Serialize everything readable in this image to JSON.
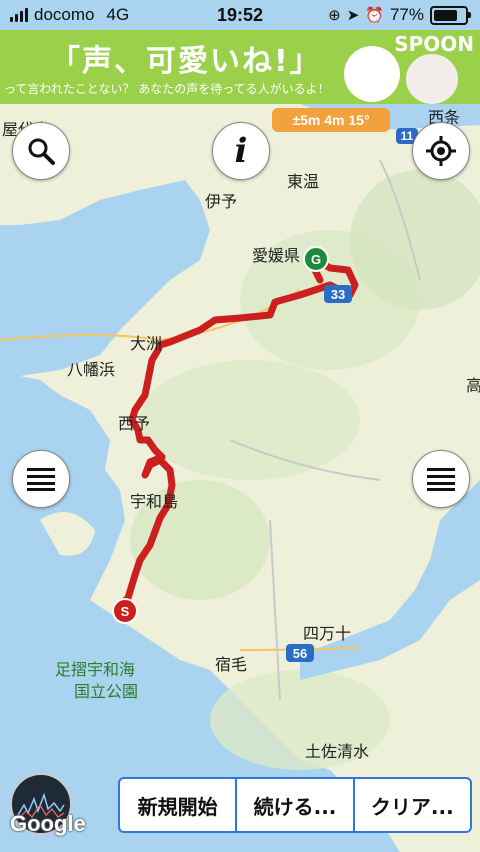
{
  "status_bar": {
    "carrier": "docomo",
    "network": "4G",
    "time": "19:52",
    "battery": "77%",
    "battery_level": 0.77
  },
  "ad": {
    "headline": "「声、可愛いね!」",
    "subtext": "って言われたことない？ あなたの声を待ってる人がいるよ！",
    "brand": "SPOON"
  },
  "gps_accuracy": "±5m 4m 15°",
  "map": {
    "labels": {
      "matsuyama_partial": "屋代島",
      "iyo": "伊予",
      "toon": "東温",
      "ehime": "愛媛県",
      "ozu": "大洲",
      "yawatahama": "八幡浜",
      "seiyo": "西予",
      "uwajima": "宇和島",
      "shimanto": "四万十",
      "sukumo": "宿毛",
      "ashizuri1": "足摺宇和海",
      "ashizuri2": "国立公園",
      "tosashimizu": "土佐清水",
      "saijo_partial": "西条",
      "kochi_partial": "高"
    },
    "route_shields": [
      "33",
      "56",
      "11"
    ],
    "markers": {
      "start": "S",
      "goal": "G"
    }
  },
  "buttons": {
    "new_start": "新規開始",
    "continue": "続ける...",
    "clear": "クリア..."
  },
  "google_logo": "Google",
  "colors": {
    "route": "#cc1f1f",
    "accent": "#2f78d8",
    "gps_badge": "#f2a13c"
  }
}
